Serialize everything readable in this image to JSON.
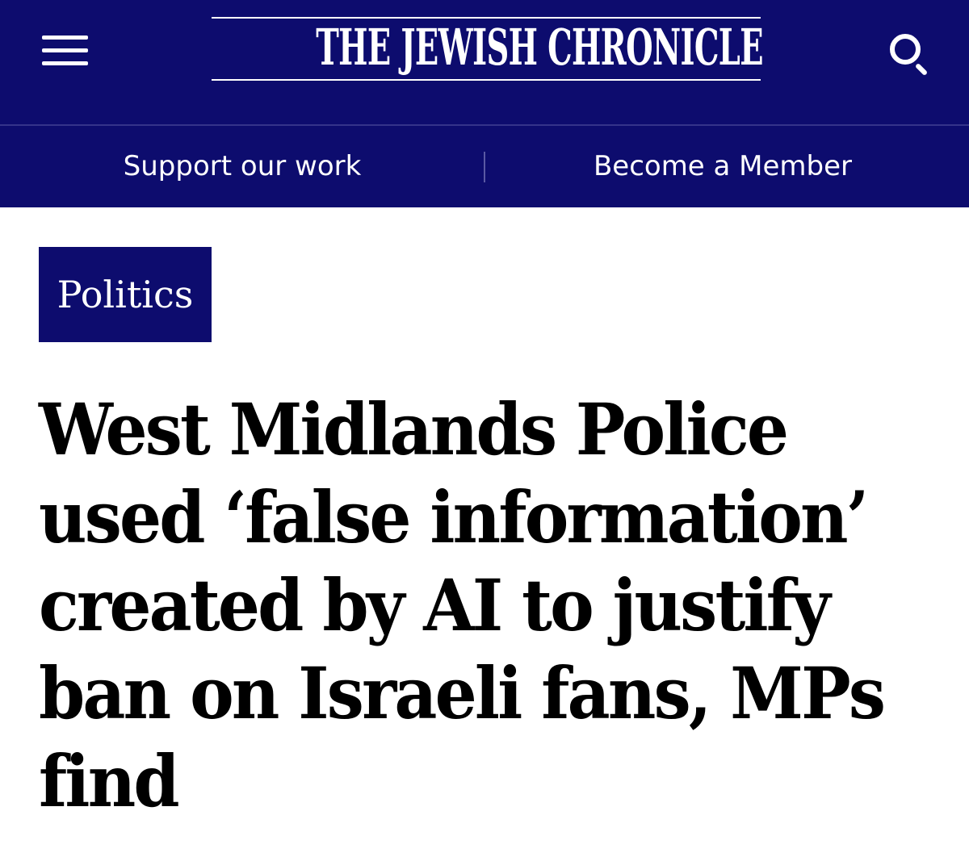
{
  "header": {
    "masthead": "THE JEWISH CHRONICLE",
    "menu_icon": "hamburger-menu-icon",
    "search_icon": "search-icon",
    "background_color": "#0d0c6e",
    "text_color": "#ffffff"
  },
  "subnav": {
    "support_label": "Support our work",
    "member_label": "Become a Member"
  },
  "article": {
    "category": "Politics",
    "headline_lines": [
      "West Midlands Police",
      "used ‘false information’",
      "created by AI to justify",
      "ban on Israeli fans, MPs",
      "find"
    ]
  }
}
